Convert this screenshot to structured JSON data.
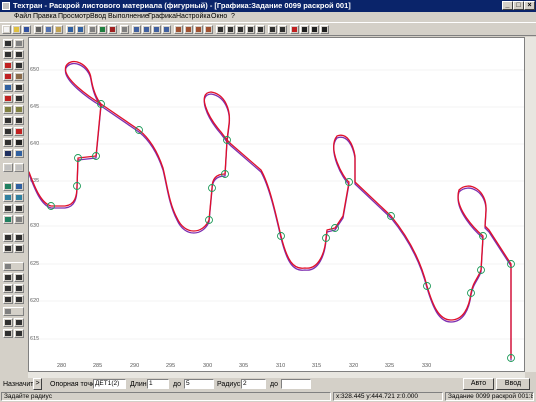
{
  "window": {
    "title": "Техтран - Раскрой листового материала (фигурный) - [Графика:Задание 0099 раскрой 001]",
    "controls": [
      "_",
      "□",
      "×"
    ]
  },
  "menu": [
    "Файл",
    "Правка",
    "Просмотр",
    "Ввод",
    "Выполнение",
    "Графика",
    "Настройка",
    "Окно",
    "?"
  ],
  "canvas": {
    "y_ticks": [
      "650",
      "645",
      "640",
      "635",
      "630",
      "625",
      "620",
      "615"
    ],
    "x_ticks": [
      "280",
      "285",
      "290",
      "295",
      "300",
      "305",
      "310",
      "315",
      "320",
      "325",
      "330"
    ]
  },
  "bottom": {
    "assign_label": "Назначить",
    "assign_arrow": ">",
    "ref_point_label": "Опорная точка:",
    "ref_point_value": "ДЕТ1(2)",
    "length_label": "Длина:",
    "length_value": "1",
    "to1_label": "до",
    "to1_value": "5",
    "radius_label": "Радиус:",
    "radius_value": "2",
    "to2_label": "до",
    "to2_value": "",
    "auto_button": "Авто",
    "enter_button": "Ввод"
  },
  "status": {
    "hint": "Задайте радиус",
    "coords": "x:328.445 y:444.721 z:0.000",
    "document": "Задание 0099 раскрой 001:85"
  },
  "colors": {
    "title_bg": "#0a246a",
    "path_red": "#e0102a",
    "path_violet": "#7d2fb0",
    "marker_green": "#1d9a58"
  }
}
